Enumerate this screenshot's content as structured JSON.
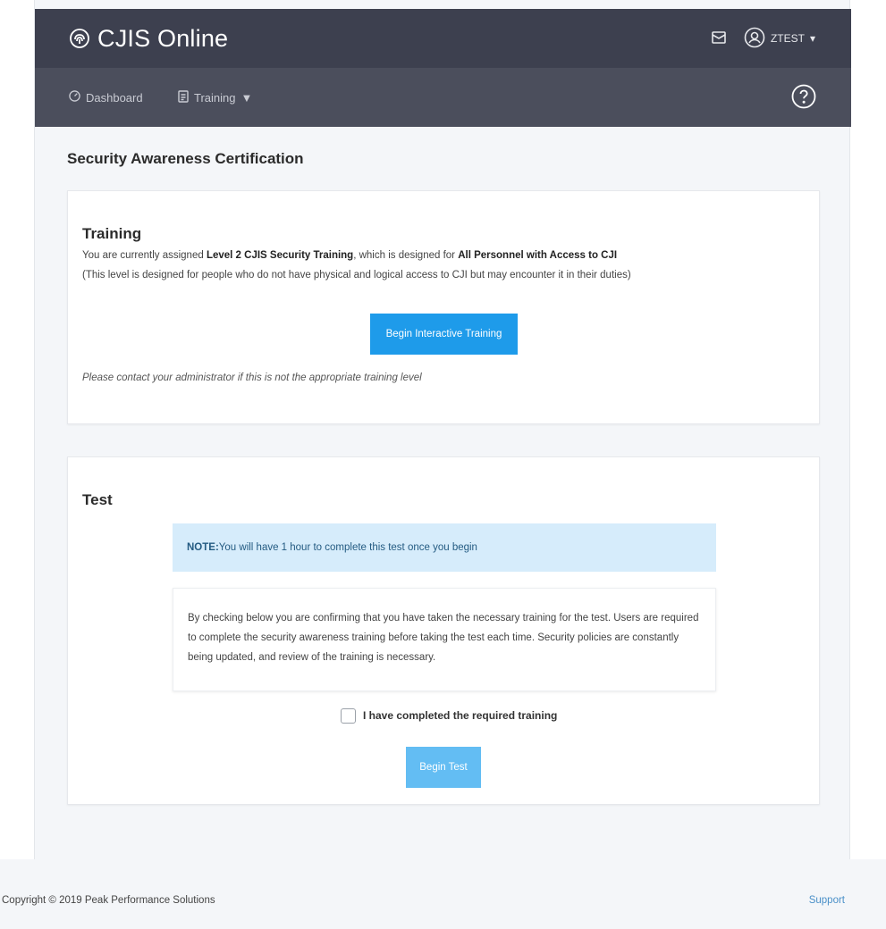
{
  "header": {
    "brand": "CJIS Online",
    "username": "ZTEST"
  },
  "nav": {
    "dashboard": "Dashboard",
    "training": "Training"
  },
  "page": {
    "title": "Security Awareness Certification"
  },
  "training_card": {
    "heading": "Training",
    "assigned_prefix": "You are currently assigned ",
    "assigned_level": "Level 2 CJIS Security Training",
    "assigned_middle": ", which is designed for ",
    "assigned_audience": "All Personnel with Access to CJI",
    "description": "(This level is designed for people who do not have physical and logical access to CJI but may encounter it in their duties)",
    "begin_button": "Begin Interactive Training",
    "contact_note": "Please contact your administrator if this is not the appropriate training level"
  },
  "test_card": {
    "heading": "Test",
    "note_label": "NOTE:",
    "note_text": " You will have 1 hour to complete this test once you begin",
    "confirm_text": "By checking below you are confirming that you have taken the necessary training for the test. Users are required to complete the security awareness training before taking the test each time. Security policies are constantly being updated, and review of the training is necessary.",
    "checkbox_label": "I have completed the required training",
    "checkbox_checked": false,
    "begin_button": "Begin Test"
  },
  "footer": {
    "copyright": "Copyright © 2019 Peak Performance Solutions",
    "support": "Support"
  },
  "colors": {
    "topbar": "#3d404f",
    "navbar": "#4b4e5c",
    "primary_button": "#1e9bea",
    "disabled_button": "#63bdf3",
    "note_bg": "#d6ecfb"
  },
  "icons": {
    "brand": "fingerprint-icon",
    "mail": "envelope-icon",
    "user": "user-circle-icon",
    "dashboard": "gauge-icon",
    "training": "document-icon",
    "help": "question-circle-icon"
  }
}
